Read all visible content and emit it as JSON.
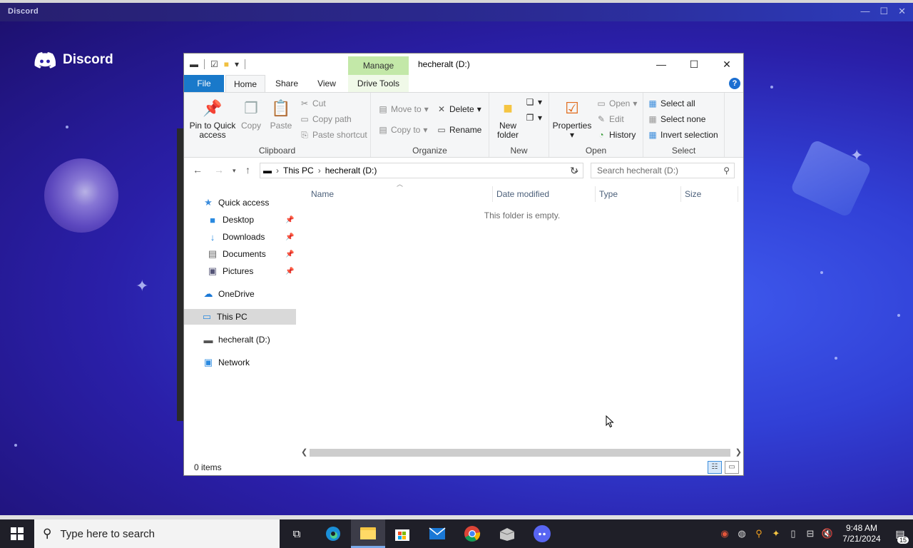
{
  "background": {
    "app_title": "Discord",
    "logo_text": "Discord",
    "controls": [
      "—",
      "☐",
      "✕"
    ]
  },
  "window": {
    "quick_access_toolbar": {
      "dropdown": "▾"
    },
    "contextual_tab": "Manage",
    "title": "hecheralt (D:)",
    "controls": {
      "minimize": "—",
      "maximize": "☐",
      "close": "✕"
    }
  },
  "ribbon_tabs": {
    "file": "File",
    "home": "Home",
    "share": "Share",
    "view": "View",
    "drive_tools": "Drive Tools",
    "help": "?"
  },
  "ribbon": {
    "clipboard": {
      "label": "Clipboard",
      "pin_to_quick_access_1": "Pin to Quick",
      "pin_to_quick_access_2": "access",
      "copy": "Copy",
      "paste": "Paste",
      "cut": "Cut",
      "copy_path": "Copy path",
      "paste_shortcut": "Paste shortcut"
    },
    "organize": {
      "label": "Organize",
      "move_to": "Move to",
      "copy_to": "Copy to",
      "delete": "Delete",
      "rename": "Rename"
    },
    "new": {
      "label": "New",
      "new_folder_1": "New",
      "new_folder_2": "folder"
    },
    "open": {
      "label": "Open",
      "properties": "Properties",
      "open": "Open",
      "edit": "Edit",
      "history": "History"
    },
    "select": {
      "label": "Select",
      "select_all": "Select all",
      "select_none": "Select none",
      "invert_selection": "Invert selection"
    }
  },
  "navigation": {
    "breadcrumb": [
      "This PC",
      "hecheralt (D:)"
    ],
    "search_placeholder": "Search hecheralt (D:)"
  },
  "nav_pane": {
    "quick_access": "Quick access",
    "desktop": "Desktop",
    "downloads": "Downloads",
    "documents": "Documents",
    "pictures": "Pictures",
    "onedrive": "OneDrive",
    "this_pc": "This PC",
    "drive_d": "hecheralt (D:)",
    "network": "Network"
  },
  "content": {
    "columns": [
      "Name",
      "Date modified",
      "Type",
      "Size"
    ],
    "empty_message": "This folder is empty."
  },
  "status_bar": {
    "item_count": "0 items"
  },
  "taskbar": {
    "search_placeholder": "Type here to search",
    "time": "9:48 AM",
    "date": "7/21/2024",
    "notification_count": "15"
  }
}
